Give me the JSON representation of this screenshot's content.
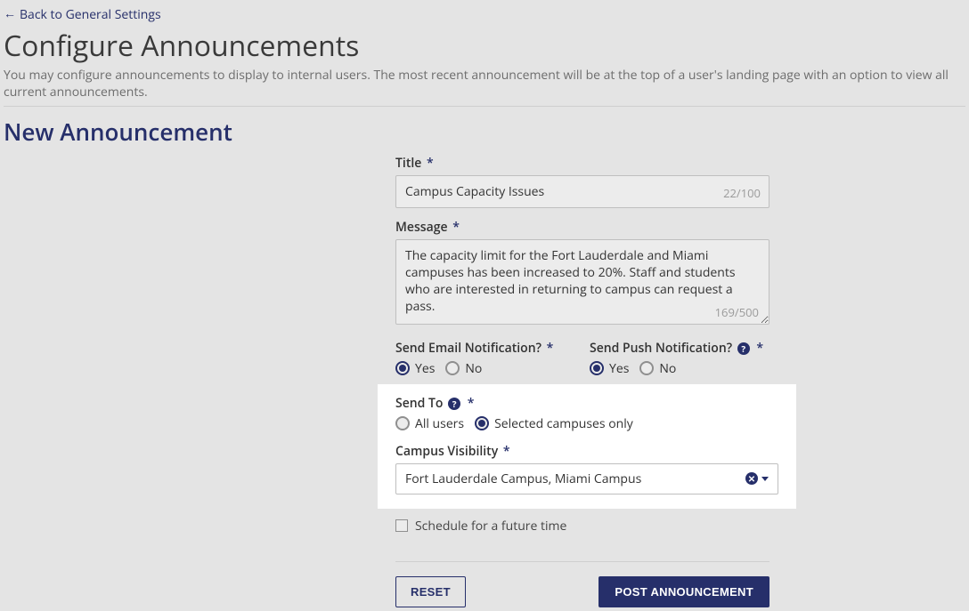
{
  "nav": {
    "back_label": "Back to General Settings"
  },
  "header": {
    "title": "Configure Announcements",
    "description": "You may configure announcements to display to internal users. The most recent announcement will be at the top of a user's landing page with an option to view all current announcements."
  },
  "section": {
    "title": "New Announcement"
  },
  "form": {
    "title_label": "Title",
    "title_value": "Campus Capacity Issues",
    "title_counter": "22/100",
    "message_label": "Message",
    "message_value": "The capacity limit for the Fort Lauderdale and Miami campuses has been increased to 20%. Staff and students who are interested in returning to campus can request a pass.",
    "message_counter": "169/500",
    "email_label": "Send Email Notification?",
    "push_label": "Send Push Notification?",
    "yes_label": "Yes",
    "no_label": "No",
    "sendto_label": "Send To",
    "sendto_all": "All users",
    "sendto_selected": "Selected campuses only",
    "campus_label": "Campus Visibility",
    "campus_value": "Fort Lauderdale Campus, Miami Campus",
    "schedule_label": "Schedule for a future time",
    "reset_button": "RESET",
    "post_button": "POST ANNOUNCEMENT",
    "help_glyph": "?",
    "required_mark": "*"
  }
}
